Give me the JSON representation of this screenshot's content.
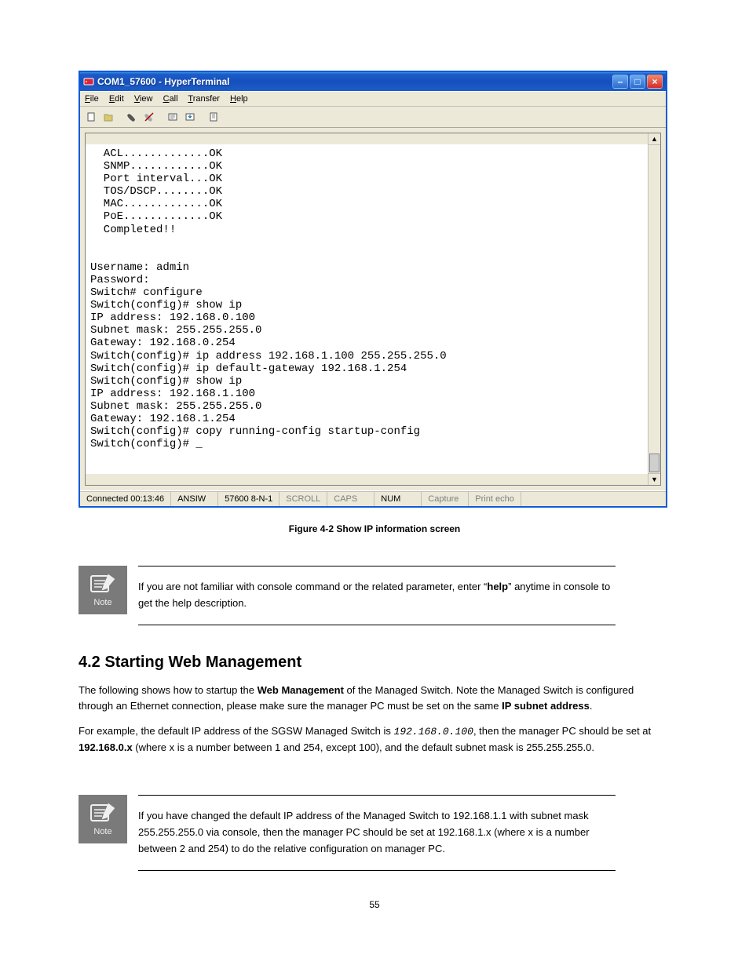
{
  "ht": {
    "title": "COM1_57600 - HyperTerminal",
    "menus": {
      "file": "File",
      "edit": "Edit",
      "view": "View",
      "call": "Call",
      "transfer": "Transfer",
      "help": "Help"
    },
    "terminal_text": "  ACL.............OK\n  SNMP............OK\n  Port interval...OK\n  TOS/DSCP........OK\n  MAC.............OK\n  PoE.............OK\n  Completed!!\n\n\nUsername: admin\nPassword:\nSwitch# configure\nSwitch(config)# show ip\nIP address: 192.168.0.100\nSubnet mask: 255.255.255.0\nGateway: 192.168.0.254\nSwitch(config)# ip address 192.168.1.100 255.255.255.0\nSwitch(config)# ip default-gateway 192.168.1.254\nSwitch(config)# show ip\nIP address: 192.168.1.100\nSubnet mask: 255.255.255.0\nGateway: 192.168.1.254\nSwitch(config)# copy running-config startup-config\nSwitch(config)# _",
    "status": {
      "connected": "Connected 00:13:46",
      "term": "ANSIW",
      "settings": "57600 8-N-1",
      "scroll": "SCROLL",
      "caps": "CAPS",
      "num": "NUM",
      "capture": "Capture",
      "printecho": "Print echo"
    }
  },
  "doc": {
    "fig_caption": "Figure 4-2 Show IP information screen",
    "note_label": "Note",
    "note1_text": "If you are not familiar with console command or the related parameter, enter “help” anytime in console to get the help description.",
    "section_title": "4.2 Starting Web Management",
    "p1": "The following shows how to startup the Web Management of the Managed Switch. Note the Managed Switch is configured through an Ethernet connection, please make sure the manager PC must be set on the same IP subnet address.",
    "p2_pre": "For example, the default IP address of the SGSW Managed Switch is ",
    "p2_ip": "192.168.0.100",
    "p2_mid": ", then the manager PC should be set at ",
    "p2_ip2": "192.168.0.x",
    "p2_post": " (where x is a number between 1 and 254, except 100), and the default subnet mask is 255.255.255.0.",
    "note2_html_pre": "If you have changed the default IP address of the Managed Switch to 192.168.1.1 with subnet mask 255.255.255.0 via console, then the manager PC should be set at 192.168.1.x (where x is a number between 2 and 254) to do the relative configuration on manager PC.",
    "page_number": "55"
  }
}
